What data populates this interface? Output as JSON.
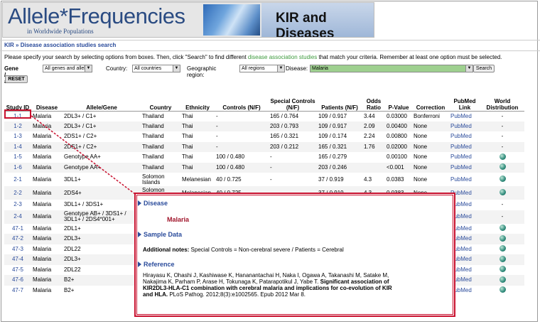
{
  "banner": {
    "site_title": "Allele*Frequencies",
    "site_subtitle": "in Worldwide Populations",
    "section_title": "KIR and Diseases"
  },
  "breadcrumb": {
    "root": "KIR",
    "sep": "»",
    "current": "Disease association studies search"
  },
  "instructions": {
    "pre": "Please specify your search by selecting options from boxes. Then, click \"Search\" to find different ",
    "link": "disease association studies",
    "post": " that match your criteria. Remember at least one option must be selected."
  },
  "filters": {
    "gene_label": "Gene / allele:",
    "gene_value": "All genes and alleles",
    "country_label": "Country:",
    "country_value": "All countries",
    "region_label": "Geographic region:",
    "region_value": "All regions",
    "disease_label": "Disease:",
    "disease_value": "Malaria",
    "search_label": "Search",
    "reset_label": "RESET"
  },
  "table": {
    "headers": [
      "Study ID",
      "Disease",
      "Allele/Gene",
      "Country",
      "Ethnicity",
      "Controls (N/F)",
      "Special Controls (N/F)",
      "Patients (N/F)",
      "Odds Ratio",
      "P-Value",
      "Correction",
      "PubMed Link",
      "World Distribution"
    ],
    "rows": [
      {
        "id": "1-1",
        "disease": "Malaria",
        "gene": "2DL3+ / C1+",
        "country": "Thailand",
        "ethnicity": "Thai",
        "controls": "-",
        "special": "165 / 0.764",
        "patients": "109 / 0.917",
        "odds": "3.44",
        "p": "0.03000",
        "correction": "Bonferroni",
        "pubmed": "PubMed",
        "world": "-"
      },
      {
        "id": "1-2",
        "disease": "Malaria",
        "gene": "2DL3+ / C1+",
        "country": "Thailand",
        "ethnicity": "Thai",
        "controls": "-",
        "special": "203 / 0.793",
        "patients": "109 / 0.917",
        "odds": "2.09",
        "p": "0.00400",
        "correction": "None",
        "pubmed": "PubMed",
        "world": "-"
      },
      {
        "id": "1-3",
        "disease": "Malaria",
        "gene": "2DS1+ / C2+",
        "country": "Thailand",
        "ethnicity": "Thai",
        "controls": "-",
        "special": "165 / 0.321",
        "patients": "109 / 0.174",
        "odds": "2.24",
        "p": "0.00800",
        "correction": "None",
        "pubmed": "PubMed",
        "world": "-"
      },
      {
        "id": "1-4",
        "disease": "Malaria",
        "gene": "2DS1+ / C2+",
        "country": "Thailand",
        "ethnicity": "Thai",
        "controls": "-",
        "special": "203 / 0.212",
        "patients": "165 / 0.321",
        "odds": "1.76",
        "p": "0.02000",
        "correction": "None",
        "pubmed": "PubMed",
        "world": "-"
      },
      {
        "id": "1-5",
        "disease": "Malaria",
        "gene": "Genotype AA+",
        "country": "Thailand",
        "ethnicity": "Thai",
        "controls": "100 / 0.480",
        "special": "-",
        "patients": "165 / 0.279",
        "odds": "",
        "p": "0.00100",
        "correction": "None",
        "pubmed": "PubMed",
        "world": "globe"
      },
      {
        "id": "1-6",
        "disease": "Malaria",
        "gene": "Genotype AA+",
        "country": "Thailand",
        "ethnicity": "Thai",
        "controls": "100 / 0.480",
        "special": "-",
        "patients": "203 / 0.246",
        "odds": "",
        "p": "<0.001",
        "correction": "None",
        "pubmed": "PubMed",
        "world": "globe"
      },
      {
        "id": "2-1",
        "disease": "Malaria",
        "gene": "3DL1+",
        "country": "Solomon Islands",
        "ethnicity": "Melanesian",
        "controls": "40 / 0.725",
        "special": "-",
        "patients": "37 / 0.919",
        "odds": "4.3",
        "p": "0.0383",
        "correction": "None",
        "pubmed": "PubMed",
        "world": "globe"
      },
      {
        "id": "2-2",
        "disease": "Malaria",
        "gene": "2DS4+",
        "country": "Solomon Islands",
        "ethnicity": "Melanesian",
        "controls": "40 / 0.725",
        "special": "-",
        "patients": "37 / 0.919",
        "odds": "4.3",
        "p": "0.0383",
        "correction": "None",
        "pubmed": "PubMed",
        "world": "globe"
      },
      {
        "id": "2-3",
        "disease": "Malaria",
        "gene": "3DL1+ / 3DS1+",
        "country": "",
        "ethnicity": "",
        "controls": "",
        "special": "",
        "patients": "",
        "odds": "",
        "p": "",
        "correction": "",
        "pubmed": "PubMed",
        "world": "-"
      },
      {
        "id": "2-4",
        "disease": "Malaria",
        "gene": "Genotype AB+ / 3DS1+ / 3DL1+ / 2DS4*001+",
        "country": "",
        "ethnicity": "",
        "controls": "",
        "special": "",
        "patients": "",
        "odds": "",
        "p": "",
        "correction": "",
        "pubmed": "PubMed",
        "world": "-"
      },
      {
        "id": "47-1",
        "disease": "Malaria",
        "gene": "2DL1+",
        "country": "",
        "ethnicity": "",
        "controls": "",
        "special": "",
        "patients": "",
        "odds": "",
        "p": "",
        "correction": "",
        "pubmed": "PubMed",
        "world": "globe"
      },
      {
        "id": "47-2",
        "disease": "Malaria",
        "gene": "2DL3+",
        "country": "",
        "ethnicity": "",
        "controls": "",
        "special": "",
        "patients": "",
        "odds": "",
        "p": "",
        "correction": "",
        "pubmed": "PubMed",
        "world": "globe"
      },
      {
        "id": "47-3",
        "disease": "Malaria",
        "gene": "2DL22",
        "country": "",
        "ethnicity": "",
        "controls": "",
        "special": "",
        "patients": "",
        "odds": "",
        "p": "",
        "correction": "",
        "pubmed": "PubMed",
        "world": "globe"
      },
      {
        "id": "47-4",
        "disease": "Malaria",
        "gene": "2DL3+",
        "country": "",
        "ethnicity": "",
        "controls": "",
        "special": "",
        "patients": "",
        "odds": "",
        "p": "",
        "correction": "",
        "pubmed": "PubMed",
        "world": "globe"
      },
      {
        "id": "47-5",
        "disease": "Malaria",
        "gene": "2DL22",
        "country": "",
        "ethnicity": "",
        "controls": "",
        "special": "",
        "patients": "",
        "odds": "",
        "p": "",
        "correction": "",
        "pubmed": "PubMed",
        "world": "globe"
      },
      {
        "id": "47-6",
        "disease": "Malaria",
        "gene": "B2+",
        "country": "",
        "ethnicity": "",
        "controls": "",
        "special": "",
        "patients": "",
        "odds": "",
        "p": "",
        "correction": "",
        "pubmed": "PubMed",
        "world": "globe"
      },
      {
        "id": "47-7",
        "disease": "Malaria",
        "gene": "B2+",
        "country": "",
        "ethnicity": "",
        "controls": "",
        "special": "",
        "patients": "",
        "odds": "",
        "p": "",
        "correction": "",
        "pubmed": "PubMed",
        "world": "globe"
      }
    ]
  },
  "popup": {
    "disease_heading": "Disease",
    "disease_value": "Malaria",
    "sample_heading": "Sample Data",
    "notes_label": "Additional notes:",
    "notes_text": " Special Controls = Non-cerebral severe / Patients = Cerebral",
    "reference_heading": "Reference",
    "ref_authors": "Hirayasu K, Ohashi J, Kashiwase K, Hananantachai H, Naka I, Ogawa A, Takanashi M, Satake M, Nakajima K, Parham P, Arase H, Tokunaga K, Patarapotikul J, Yabe T. ",
    "ref_title": "Significant association of KIR2DL3-HLA-C1 combination with cerebral malaria and implications for co-evolution of KIR and HLA.",
    "ref_source": " PLoS Pathog. 2012;8(3):e1002565. Epub 2012 Mar 8."
  },
  "colors": {
    "accent": "#2a4b9b",
    "highlight": "#c8102e",
    "disease_select": "#9ed08f",
    "link_green": "#3d9a3d"
  }
}
